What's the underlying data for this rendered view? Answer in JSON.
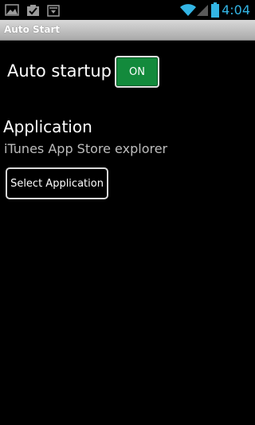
{
  "status_bar": {
    "time": "4:04",
    "time_color": "#33b5e5",
    "left_icons": [
      "image-icon",
      "checklist-icon",
      "download-icon"
    ],
    "right_icons": [
      "wifi-icon",
      "signal-icon",
      "battery-icon"
    ]
  },
  "title_bar": {
    "title": "Auto Start"
  },
  "auto_startup": {
    "label": "Auto startup",
    "toggle_label": "ON",
    "toggle_color": "#138a3c"
  },
  "application": {
    "heading": "Application",
    "selected_app": "iTunes App Store explorer",
    "select_button_label": "Select Application"
  }
}
